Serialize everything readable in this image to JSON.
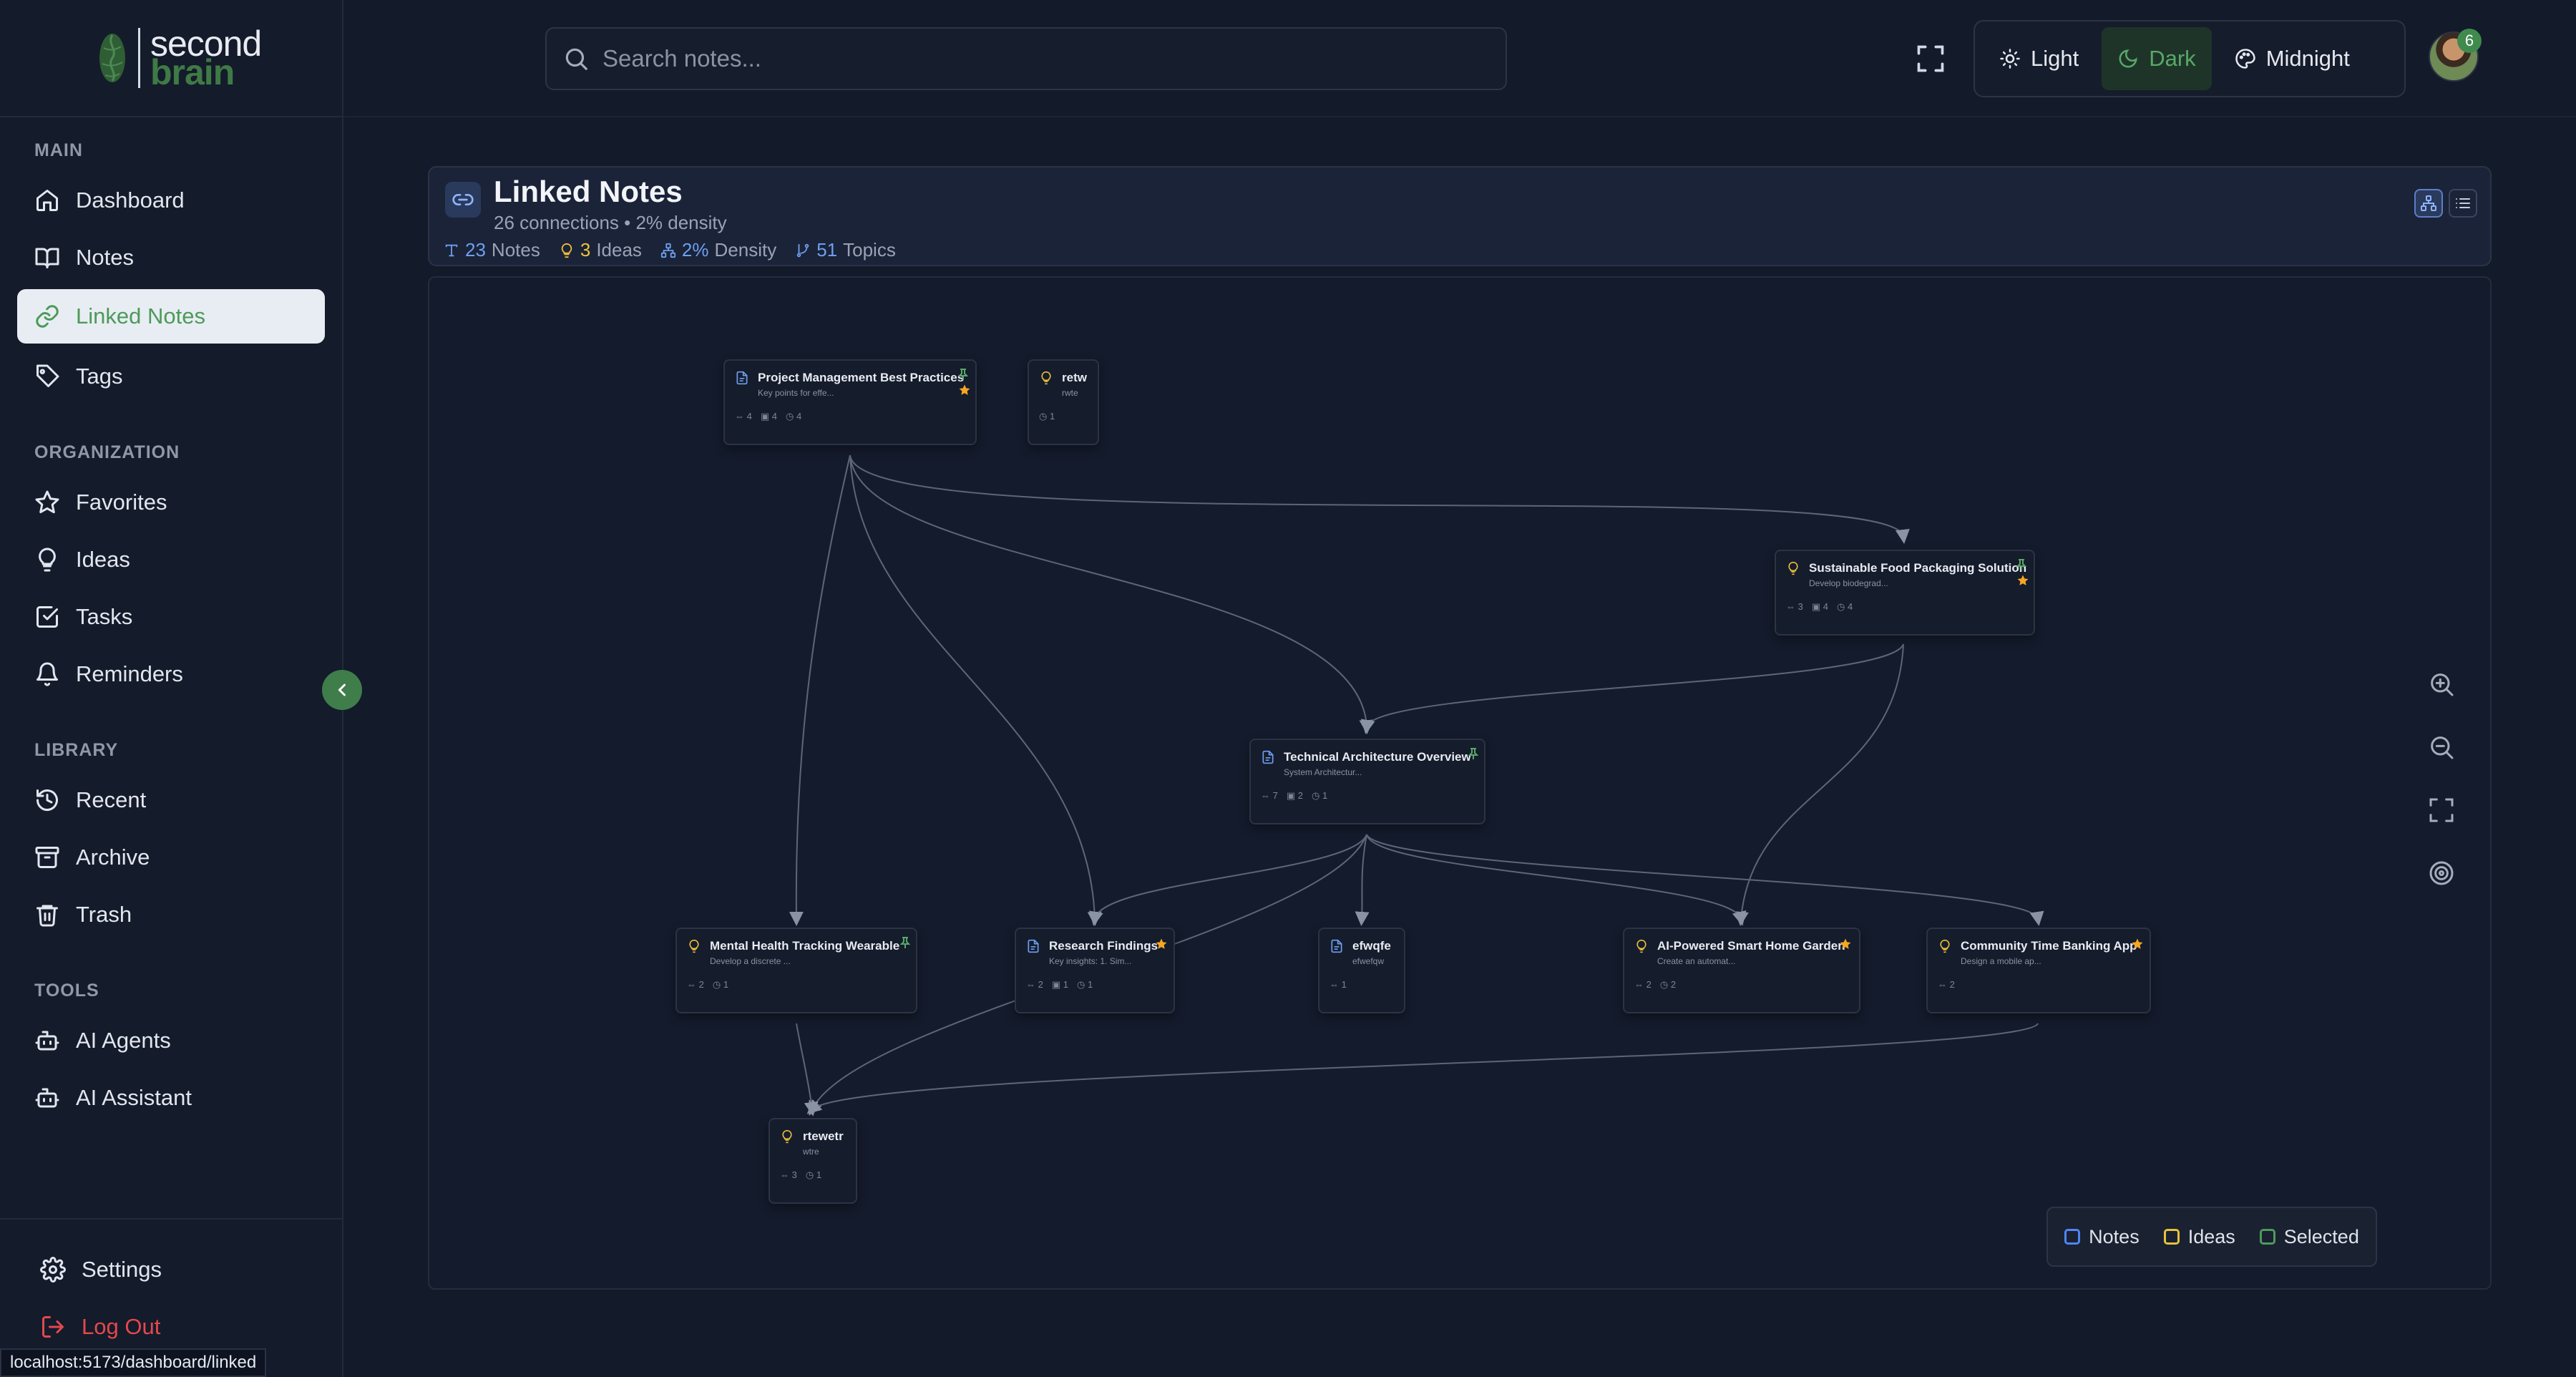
{
  "app": {
    "logo_text_1": "second",
    "logo_text_2": "brain"
  },
  "sidebar": {
    "sections": [
      {
        "label": "MAIN"
      },
      {
        "label": "ORGANIZATION"
      },
      {
        "label": "LIBRARY"
      },
      {
        "label": "TOOLS"
      }
    ],
    "items": [
      {
        "label": "Dashboard",
        "icon": "home-icon"
      },
      {
        "label": "Notes",
        "icon": "book-icon"
      },
      {
        "label": "Linked Notes",
        "icon": "link-icon",
        "active": true
      },
      {
        "label": "Tags",
        "icon": "tag-icon"
      },
      {
        "label": "Favorites",
        "icon": "star-icon"
      },
      {
        "label": "Ideas",
        "icon": "lightbulb-icon"
      },
      {
        "label": "Tasks",
        "icon": "checkbox-icon"
      },
      {
        "label": "Reminders",
        "icon": "bell-icon"
      },
      {
        "label": "Recent",
        "icon": "history-icon"
      },
      {
        "label": "Archive",
        "icon": "archive-icon"
      },
      {
        "label": "Trash",
        "icon": "trash-icon"
      },
      {
        "label": "AI Agents",
        "icon": "bot-icon"
      },
      {
        "label": "AI Assistant",
        "icon": "bot-icon"
      }
    ],
    "settings_label": "Settings",
    "logout_label": "Log Out"
  },
  "status_bar": {
    "url": "localhost:5173/dashboard/linked"
  },
  "topbar": {
    "search_placeholder": "Search notes...",
    "themes": [
      {
        "label": "Light"
      },
      {
        "label": "Dark",
        "active": true
      },
      {
        "label": "Midnight"
      }
    ],
    "notification_count": "6"
  },
  "header": {
    "title": "Linked Notes",
    "subtitle": "26 connections • 2% density",
    "stats": [
      {
        "value": "23",
        "label": "Notes"
      },
      {
        "value": "3",
        "label": "Ideas"
      },
      {
        "value": "2%",
        "label": "Density"
      },
      {
        "value": "51",
        "label": "Topics"
      }
    ]
  },
  "graph": {
    "nodes": [
      {
        "title": "Project Management Best Practices",
        "excerpt": "Key points for effe...",
        "type": "note",
        "favorite": true,
        "pinned": true,
        "stats": [
          "4",
          "4",
          "4"
        ]
      },
      {
        "title": "retw",
        "excerpt": "rwte",
        "type": "idea",
        "favorite": false,
        "pinned": false,
        "stats": [
          "1"
        ]
      },
      {
        "title": "Sustainable Food Packaging Solution",
        "excerpt": "Develop biodegrad...",
        "type": "idea",
        "favorite": true,
        "pinned": true,
        "stats": [
          "3",
          "4",
          "4"
        ]
      },
      {
        "title": "Technical Architecture Overview",
        "excerpt": "System Architectur...",
        "type": "note",
        "favorite": false,
        "pinned": true,
        "stats": [
          "7",
          "2",
          "1"
        ]
      },
      {
        "title": "Mental Health Tracking Wearable",
        "excerpt": "Develop a discrete ...",
        "type": "idea",
        "favorite": false,
        "pinned": true,
        "stats": [
          "2",
          "1"
        ]
      },
      {
        "title": "Research Findings",
        "excerpt": "Key insights: 1. Sim...",
        "type": "note",
        "favorite": true,
        "pinned": false,
        "stats": [
          "2",
          "1",
          "1"
        ]
      },
      {
        "title": "efwqfe",
        "excerpt": "efwefqw",
        "type": "note",
        "favorite": false,
        "pinned": false,
        "stats": [
          "1"
        ]
      },
      {
        "title": "AI-Powered Smart Home Garden",
        "excerpt": "Create an automat...",
        "type": "idea",
        "favorite": true,
        "pinned": false,
        "stats": [
          "2",
          "2"
        ]
      },
      {
        "title": "Community Time Banking App",
        "excerpt": "Design a mobile ap...",
        "type": "idea",
        "favorite": true,
        "pinned": false,
        "stats": [
          "2"
        ]
      },
      {
        "title": "rtewetr",
        "excerpt": "wtre",
        "type": "idea",
        "favorite": false,
        "pinned": false,
        "stats": [
          "3",
          "1"
        ]
      }
    ],
    "legend": [
      {
        "label": "Notes",
        "color": "#4f86f7"
      },
      {
        "label": "Ideas",
        "color": "#e8c13a"
      },
      {
        "label": "Selected",
        "color": "#4f9a5c"
      }
    ]
  },
  "colors": {
    "accent_green": "#4d9a57",
    "note_blue": "#6f9ff0",
    "idea_yellow": "#f0c13a",
    "star": "#f5a623",
    "logout_red": "#e5484d"
  }
}
